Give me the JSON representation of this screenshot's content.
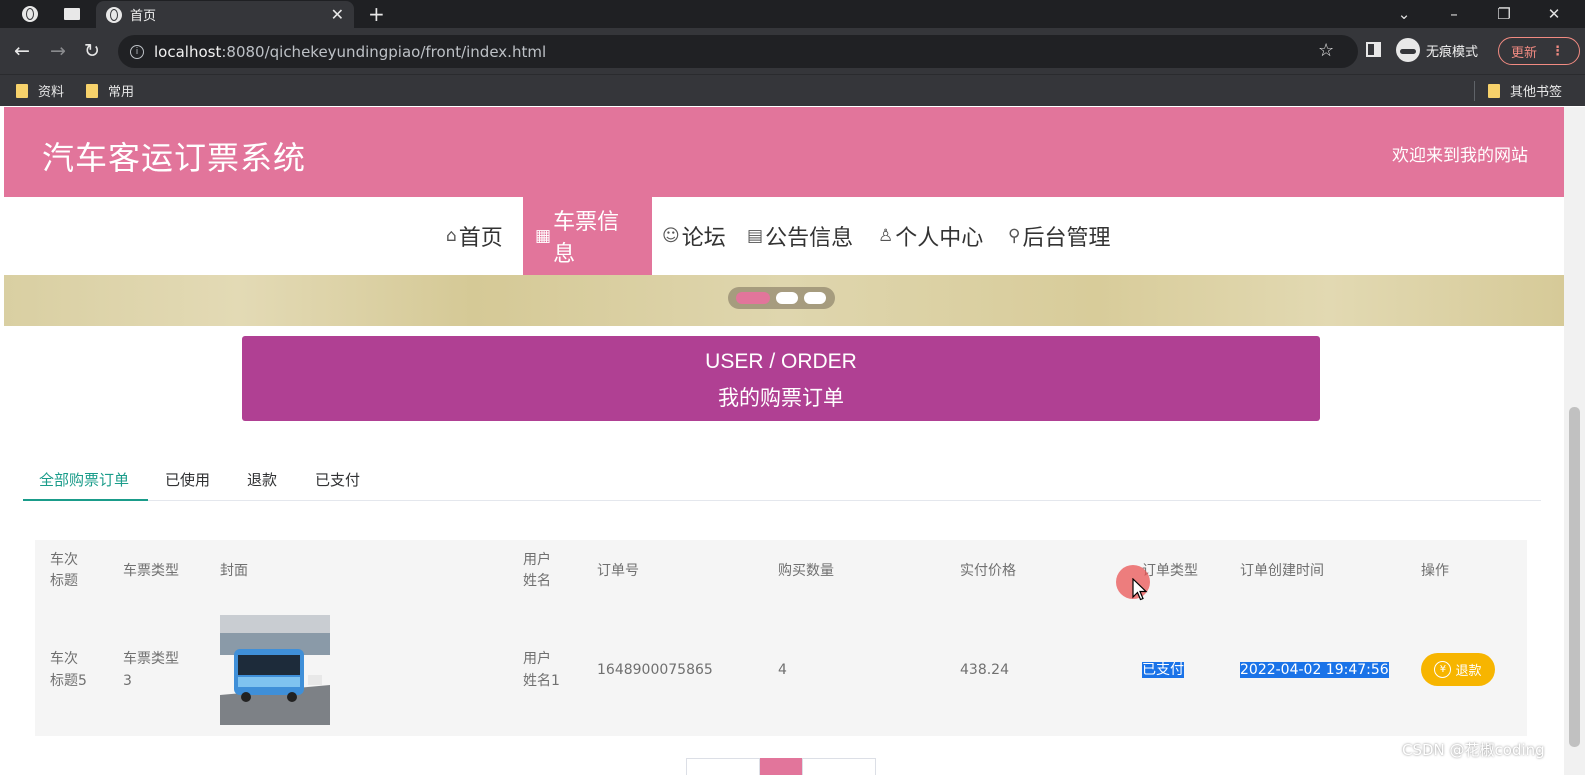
{
  "browser": {
    "tab_title": "首页",
    "tab_close": "✕",
    "new_tab": "+",
    "url_host": "localhost",
    "url_rest": ":8080/qichekeyundingpiao/front/index.html",
    "incognito_label": "无痕模式",
    "update_label": "更新",
    "bookmarks": [
      "资料",
      "常用"
    ],
    "other_bookmarks": "其他书签"
  },
  "site": {
    "title": "汽车客运订票系统",
    "welcome": "欢迎来到我的网站",
    "nav": [
      {
        "icon": "⌂",
        "label": "首页"
      },
      {
        "icon": "▦",
        "label": "车票信息"
      },
      {
        "icon": "☺",
        "label": "论坛"
      },
      {
        "icon": "▤",
        "label": "公告信息"
      },
      {
        "icon": "♙",
        "label": "个人中心"
      },
      {
        "icon": "⚲",
        "label": "后台管理"
      }
    ]
  },
  "order_banner": {
    "en": "USER / ORDER",
    "cn": "我的购票订单"
  },
  "tabs": [
    "全部购票订单",
    "已使用",
    "退款",
    "已支付"
  ],
  "table": {
    "headers": [
      [
        "车次",
        "标题"
      ],
      [
        "车票类型"
      ],
      [
        "封面"
      ],
      [
        "用户",
        "姓名"
      ],
      [
        "订单号"
      ],
      [
        "购买数量"
      ],
      [
        "实付价格"
      ],
      [
        "订单类型"
      ],
      [
        "订单创建时间"
      ],
      [
        "操作"
      ]
    ],
    "row": {
      "title": [
        "车次",
        "标题5"
      ],
      "ticket_type": [
        "车票类型",
        "3"
      ],
      "user_name": [
        "用户",
        "姓名1"
      ],
      "order_no": "1648900075865",
      "quantity": "4",
      "price": "438.24",
      "order_type": "已支付",
      "created_at": "2022-04-02 19:47:56",
      "action": "退款",
      "action_icon": "¥"
    }
  },
  "watermark": "CSDN @花椒coding",
  "colors": {
    "brand_pink": "#e2759b",
    "order_banner": "#b04093",
    "tab_active": "#1a9c8a",
    "refund_button": "#f7b500",
    "selection": "#1a73e8"
  }
}
